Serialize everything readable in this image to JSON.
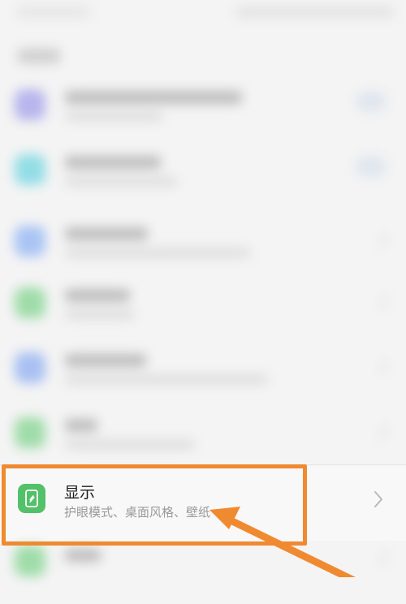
{
  "display_item": {
    "title": "显示",
    "subtitle": "护眼模式、桌面风格、壁纸",
    "icon": "display-settings-icon",
    "chevron_icon": "chevron-right-icon"
  },
  "annotation": {
    "color": "#f08a30",
    "arrow_icon": "pointer-arrow-icon"
  },
  "blurred_rows": [
    {
      "icon_color": "#b7b5ec"
    },
    {
      "icon_color": "#93dde6"
    },
    {
      "icon_color": "#a9c4f4"
    },
    {
      "icon_color": "#9fdca9"
    },
    {
      "icon_color": "#a9c0f2"
    },
    {
      "icon_color": "#9fdca9"
    }
  ]
}
